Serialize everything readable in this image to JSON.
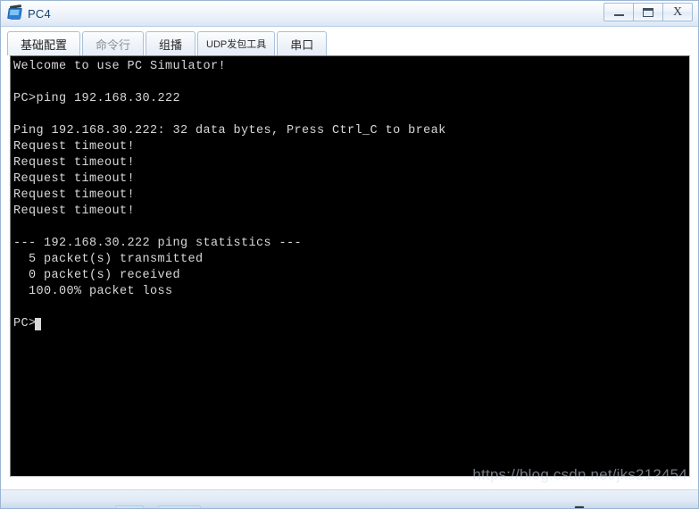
{
  "window": {
    "title": "PC4",
    "icon": "pc-monitor-icon",
    "controls": {
      "minimize": "–",
      "maximize": "▭",
      "close": "X"
    }
  },
  "tabs": [
    {
      "label": "基础配置",
      "active": true,
      "style": "normal"
    },
    {
      "label": "命令行",
      "active": false,
      "style": "dim"
    },
    {
      "label": "组播",
      "active": false,
      "style": "normal"
    },
    {
      "label": "UDP发包工具",
      "active": false,
      "style": "small"
    },
    {
      "label": "串口",
      "active": false,
      "style": "normal"
    }
  ],
  "terminal": {
    "background": "#000000",
    "foreground": "#d8d8d8",
    "lines": [
      "Welcome to use PC Simulator!",
      "",
      "PC>ping 192.168.30.222",
      "",
      "Ping 192.168.30.222: 32 data bytes, Press Ctrl_C to break",
      "Request timeout!",
      "Request timeout!",
      "Request timeout!",
      "Request timeout!",
      "Request timeout!",
      "",
      "--- 192.168.30.222 ping statistics ---",
      "  5 packet(s) transmitted",
      "  0 packet(s) received",
      "  100.00% packet loss",
      "",
      "PC>"
    ],
    "prompt": "PC>",
    "cursor_visible": true,
    "command_entered": "ping 192.168.30.222",
    "target_ip": "192.168.30.222",
    "data_bytes": "32",
    "packets_transmitted": "5",
    "packets_received": "0",
    "packet_loss": "100.00%"
  },
  "watermark": {
    "text": "https://blog.csdn.net/jks212454"
  }
}
